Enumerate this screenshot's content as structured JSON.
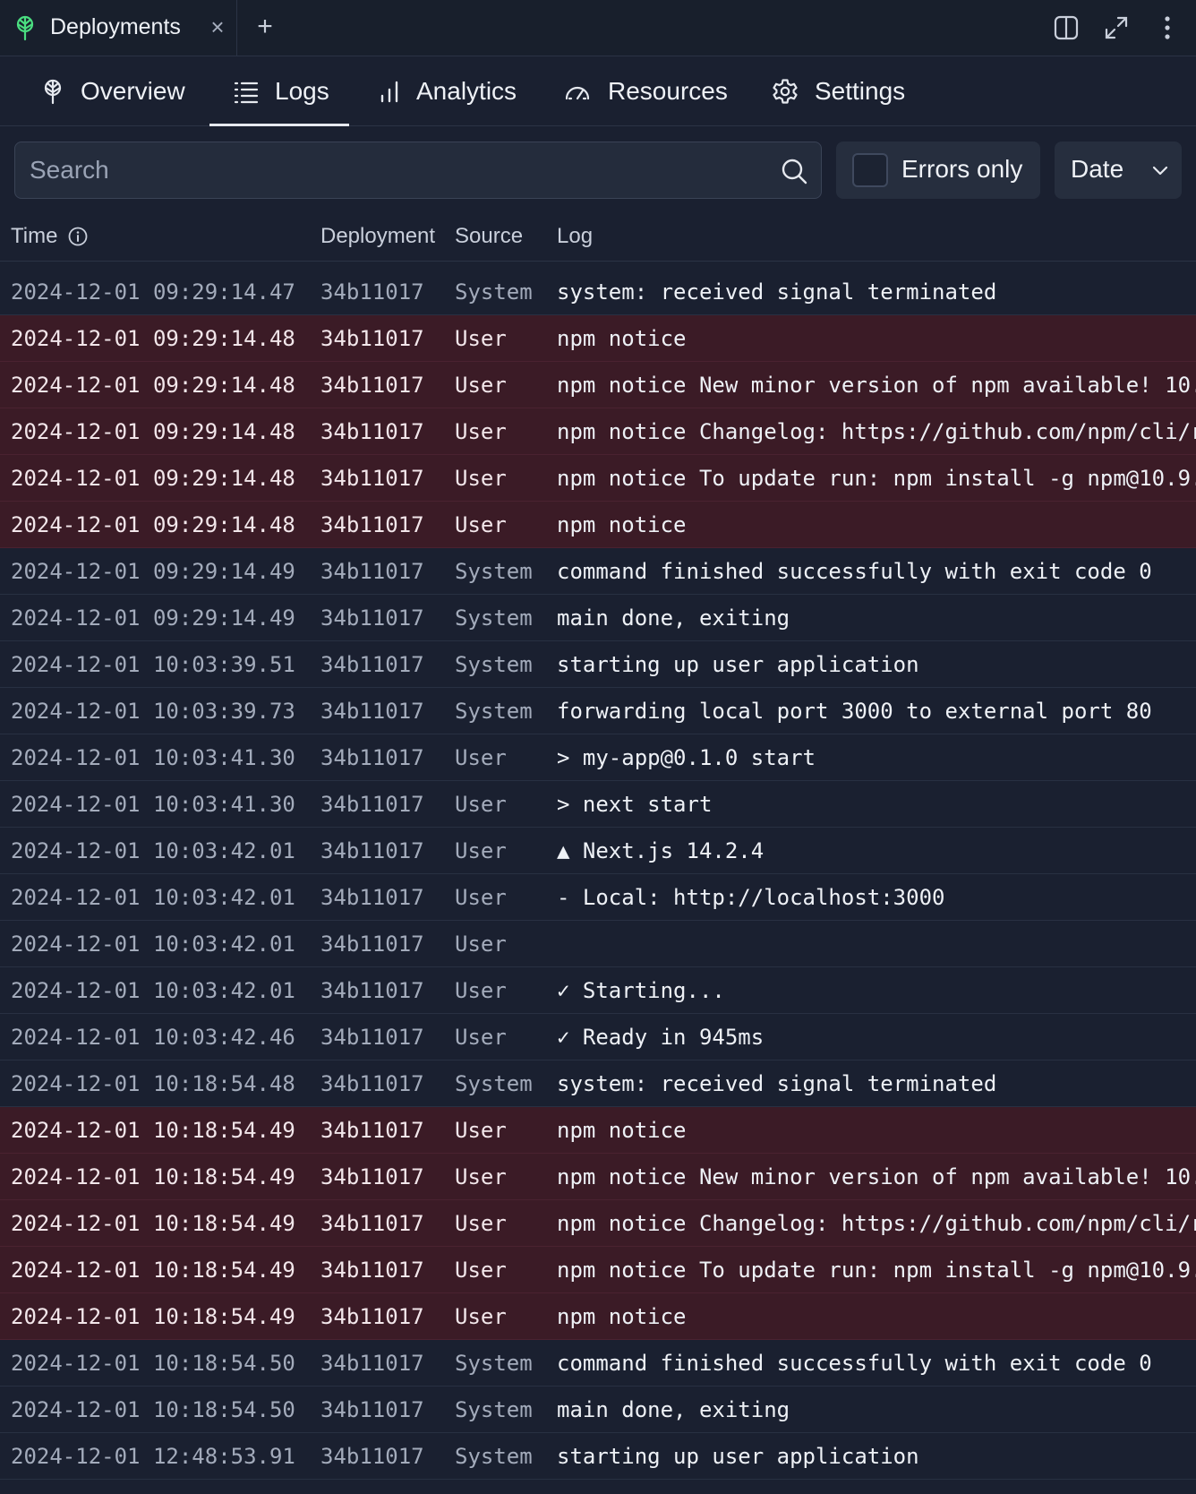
{
  "window": {
    "tab_title": "Deployments",
    "close_glyph": "×",
    "add_glyph": "+"
  },
  "nav": {
    "tabs": [
      {
        "label": "Overview",
        "icon": "tree-icon"
      },
      {
        "label": "Logs",
        "icon": "list-icon",
        "active": true
      },
      {
        "label": "Analytics",
        "icon": "bar-chart-icon"
      },
      {
        "label": "Resources",
        "icon": "gauge-icon"
      },
      {
        "label": "Settings",
        "icon": "gear-icon"
      }
    ]
  },
  "filters": {
    "search_placeholder": "Search",
    "errors_only_label": "Errors only",
    "errors_only_checked": false,
    "sort_label": "Date"
  },
  "table": {
    "columns": [
      "Time",
      "Deployment",
      "Source",
      "Log"
    ],
    "rows": [
      {
        "time": "2024-12-01 09:29:14.47",
        "deployment": "34b11017",
        "source": "System",
        "log": "system: received signal terminated",
        "error": false
      },
      {
        "time": "2024-12-01 09:29:14.48",
        "deployment": "34b11017",
        "source": "User",
        "log": "npm notice",
        "error": true
      },
      {
        "time": "2024-12-01 09:29:14.48",
        "deployment": "34b11017",
        "source": "User",
        "log": "npm notice New minor version of npm available! 10.",
        "error": true
      },
      {
        "time": "2024-12-01 09:29:14.48",
        "deployment": "34b11017",
        "source": "User",
        "log": "npm notice Changelog: https://github.com/npm/cli/r",
        "error": true
      },
      {
        "time": "2024-12-01 09:29:14.48",
        "deployment": "34b11017",
        "source": "User",
        "log": "npm notice To update run: npm install -g npm@10.9.",
        "error": true
      },
      {
        "time": "2024-12-01 09:29:14.48",
        "deployment": "34b11017",
        "source": "User",
        "log": "npm notice",
        "error": true
      },
      {
        "time": "2024-12-01 09:29:14.49",
        "deployment": "34b11017",
        "source": "System",
        "log": "command finished successfully with exit code 0",
        "error": false
      },
      {
        "time": "2024-12-01 09:29:14.49",
        "deployment": "34b11017",
        "source": "System",
        "log": "main done, exiting",
        "error": false
      },
      {
        "time": "2024-12-01 10:03:39.51",
        "deployment": "34b11017",
        "source": "System",
        "log": "starting up user application",
        "error": false
      },
      {
        "time": "2024-12-01 10:03:39.73",
        "deployment": "34b11017",
        "source": "System",
        "log": "forwarding local port 3000 to external port 80",
        "error": false
      },
      {
        "time": "2024-12-01 10:03:41.30",
        "deployment": "34b11017",
        "source": "User",
        "log": "> my-app@0.1.0 start",
        "error": false
      },
      {
        "time": "2024-12-01 10:03:41.30",
        "deployment": "34b11017",
        "source": "User",
        "log": "> next start",
        "error": false
      },
      {
        "time": "2024-12-01 10:03:42.01",
        "deployment": "34b11017",
        "source": "User",
        "log": "▲ Next.js 14.2.4",
        "error": false
      },
      {
        "time": "2024-12-01 10:03:42.01",
        "deployment": "34b11017",
        "source": "User",
        "log": "- Local: http://localhost:3000",
        "error": false
      },
      {
        "time": "2024-12-01 10:03:42.01",
        "deployment": "34b11017",
        "source": "User",
        "log": "",
        "error": false
      },
      {
        "time": "2024-12-01 10:03:42.01",
        "deployment": "34b11017",
        "source": "User",
        "log": "✓ Starting...",
        "error": false
      },
      {
        "time": "2024-12-01 10:03:42.46",
        "deployment": "34b11017",
        "source": "User",
        "log": "✓ Ready in 945ms",
        "error": false
      },
      {
        "time": "2024-12-01 10:18:54.48",
        "deployment": "34b11017",
        "source": "System",
        "log": "system: received signal terminated",
        "error": false
      },
      {
        "time": "2024-12-01 10:18:54.49",
        "deployment": "34b11017",
        "source": "User",
        "log": "npm notice",
        "error": true
      },
      {
        "time": "2024-12-01 10:18:54.49",
        "deployment": "34b11017",
        "source": "User",
        "log": "npm notice New minor version of npm available! 10.",
        "error": true
      },
      {
        "time": "2024-12-01 10:18:54.49",
        "deployment": "34b11017",
        "source": "User",
        "log": "npm notice Changelog: https://github.com/npm/cli/r",
        "error": true
      },
      {
        "time": "2024-12-01 10:18:54.49",
        "deployment": "34b11017",
        "source": "User",
        "log": "npm notice To update run: npm install -g npm@10.9.",
        "error": true
      },
      {
        "time": "2024-12-01 10:18:54.49",
        "deployment": "34b11017",
        "source": "User",
        "log": "npm notice",
        "error": true
      },
      {
        "time": "2024-12-01 10:18:54.50",
        "deployment": "34b11017",
        "source": "System",
        "log": "command finished successfully with exit code 0",
        "error": false
      },
      {
        "time": "2024-12-01 10:18:54.50",
        "deployment": "34b11017",
        "source": "System",
        "log": "main done, exiting",
        "error": false
      },
      {
        "time": "2024-12-01 12:48:53.91",
        "deployment": "34b11017",
        "source": "System",
        "log": "starting up user application",
        "error": false
      }
    ]
  },
  "colors": {
    "background": "#1a2030",
    "error_row": "#3b1b26",
    "accent_logo": "#4ade80"
  }
}
